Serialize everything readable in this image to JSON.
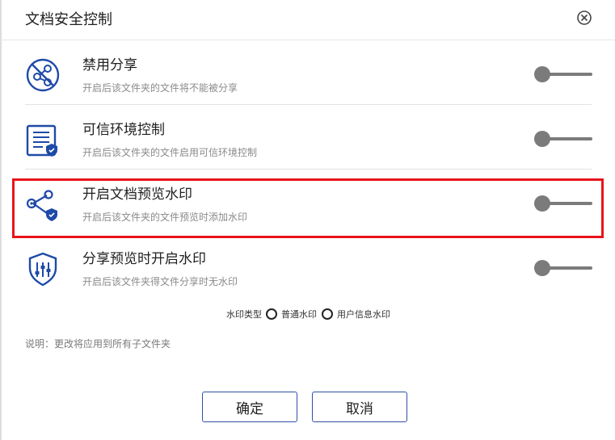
{
  "dialog": {
    "title": "文档安全控制",
    "close_icon": "close-circle-icon"
  },
  "settings": [
    {
      "icon": "share-disabled-icon",
      "title": "禁用分享",
      "description": "开启后该文件夹的文件将不能被分享",
      "enabled": false
    },
    {
      "icon": "trusted-environment-icon",
      "title": "可信环境控制",
      "description": "开启后该文件夹的文件启用可信环境控制",
      "enabled": false
    },
    {
      "icon": "preview-watermark-icon",
      "title": "开启文档预览水印",
      "description": "开启后该文件夹的文件预览时添加水印",
      "enabled": false
    },
    {
      "icon": "share-watermark-shield-icon",
      "title": "分享预览时开启水印",
      "description": "开启后该文件夹得文件分享时无水印",
      "enabled": false
    }
  ],
  "watermark": {
    "label": "水印类型",
    "options": [
      "普通水印",
      "用户信息水印"
    ]
  },
  "note": "说明：更改将应用到所有子文件夹",
  "buttons": {
    "confirm": "确定",
    "cancel": "取消"
  },
  "colors": {
    "icon_blue": "#1e4aa8",
    "highlight": "#e8141b",
    "toggle_off": "#7b7b7b"
  }
}
